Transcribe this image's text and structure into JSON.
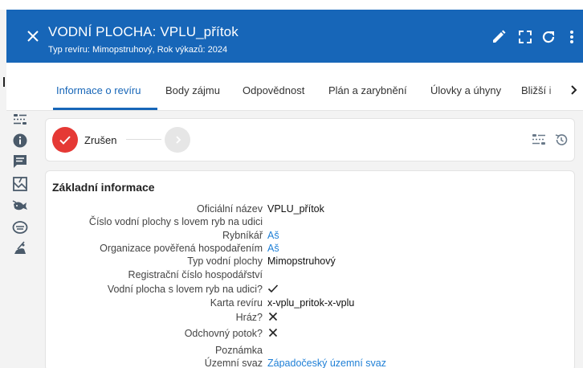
{
  "header": {
    "title": "VODNÍ PLOCHA: VPLU_přítok",
    "subtitle": "Typ revíru: Mimopstruhový, Rok výkazů: 2024",
    "bg_color": "#1766b8",
    "icons": [
      "close-icon",
      "edit-icon",
      "fullscreen-icon",
      "refresh-icon",
      "more-vert-icon"
    ]
  },
  "tabs": {
    "items": [
      {
        "label": "Informace o revíru",
        "active": true
      },
      {
        "label": "Body zájmu",
        "active": false
      },
      {
        "label": "Odpovědnost",
        "active": false
      },
      {
        "label": "Plán a zarybnění",
        "active": false
      },
      {
        "label": "Úlovky a úhyny",
        "active": false
      },
      {
        "label": "Bližší i",
        "active": false
      }
    ],
    "scroll_icon": "chevron-right-icon"
  },
  "side_icons": [
    "workflow-icon",
    "info-icon",
    "notes-icon",
    "map-icon",
    "fish-icon",
    "dam-icon",
    "fishing-icon"
  ],
  "stepper": {
    "current_label": "Zrušen",
    "current_color": "#e53935",
    "icons": [
      "check-icon",
      "chevron-right-icon",
      "workflow-icon",
      "history-icon"
    ]
  },
  "info_card": {
    "title": "Základní informace",
    "rows": [
      {
        "label": "Oficiální název",
        "value": "VPLU_přítok",
        "kind": "text"
      },
      {
        "label": "Číslo vodní plochy s lovem ryb na udici",
        "value": "",
        "kind": "text"
      },
      {
        "label": "Rybníkář",
        "value": "Aš",
        "kind": "link"
      },
      {
        "label": "Organizace pověřená hospodařením",
        "value": "Aš",
        "kind": "link"
      },
      {
        "label": "Typ vodní plochy",
        "value": "Mimopstruhový",
        "kind": "text"
      },
      {
        "label": "Registrační číslo hospodářství",
        "value": "",
        "kind": "text"
      },
      {
        "label": "Vodní plocha s lovem ryb na udici?",
        "value": "",
        "kind": "check"
      },
      {
        "label": "Karta revíru",
        "value": "x-vplu_pritok-x-vplu",
        "kind": "text"
      },
      {
        "label": "Hráz?",
        "value": "",
        "kind": "cross"
      },
      {
        "label": "Odchovný potok?",
        "value": "",
        "kind": "cross"
      },
      {
        "label": "Poznámka",
        "value": "",
        "kind": "text"
      },
      {
        "label": "Územní svaz",
        "value": "Západočeský územní svaz",
        "kind": "link"
      }
    ],
    "link_color": "#1e7fd6"
  }
}
